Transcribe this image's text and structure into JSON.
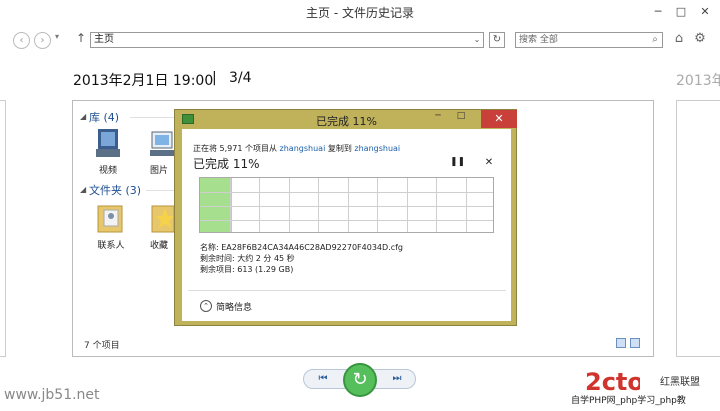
{
  "window": {
    "title": "主页 - 文件历史记录",
    "min": "─",
    "max": "□",
    "close": "✕"
  },
  "toolbar": {
    "back": "‹",
    "forward": "›",
    "up": "↑",
    "address": "主页",
    "address_drop": "⌄",
    "refresh": "↻",
    "search_placeholder": "搜索 全部",
    "search_icon": "⌕",
    "home": "⌂",
    "settings": "⚙"
  },
  "header": {
    "date": "2013年2月1日 19:00",
    "separator": "|",
    "page": "3/4",
    "next_date": "2013年"
  },
  "explorer": {
    "library_group": "库 (4)",
    "library_items": [
      {
        "label": "视频",
        "icon": "video-library-icon"
      },
      {
        "label": "图片",
        "icon": "pictures-library-icon"
      }
    ],
    "folder_group": "文件夹 (3)",
    "folder_items": [
      {
        "label": "联系人",
        "icon": "contacts-folder-icon"
      },
      {
        "label": "收藏",
        "icon": "favorites-folder-icon"
      }
    ],
    "status": "7 个项目"
  },
  "dialog": {
    "title": "已完成 11%",
    "min": "─",
    "max": "□",
    "close": "✕",
    "copy_prefix": "正在将 5,971 个项目从 ",
    "copy_source": "zhangshuai",
    "copy_middle": " 复制到 ",
    "copy_dest": "zhangshuai",
    "progress_title": "已完成 11%",
    "progress_value": 0.11,
    "pause": "❚❚",
    "stop": "✕",
    "name_line": "名称: EA28F6B24CA34A46C28AD92270F4034D.cfg",
    "time_line": "剩余时间: 大约 2 分 45 秒",
    "items_line": "剩余项目: 613 (1.29 GB)",
    "less_info": "简略信息",
    "less_icon": "⌃",
    "colors": {
      "frame": "#bfb25a",
      "progress": "#a6e08e",
      "close": "#c9403a"
    }
  },
  "bottom": {
    "prev": "⏮",
    "restore": "↻",
    "next": "⏭"
  },
  "watermarks": {
    "left": "www.jb51.net",
    "right_top": "红黑联盟",
    "right": "自学PHP网_php学习_php教"
  }
}
